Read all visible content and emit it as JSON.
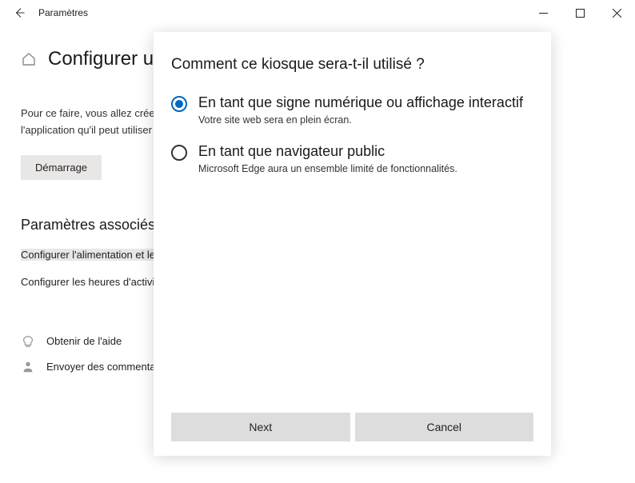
{
  "titlebar": {
    "title": "Paramètres"
  },
  "page": {
    "heading": "Configurer un",
    "intro_line1": "Pour ce faire, vous allez créer uniquement",
    "intro_line2": "l'application qu'il peut utiliser",
    "start_label": "Démarrage"
  },
  "related": {
    "heading": "Paramètres associés",
    "link1": "Configurer l'alimentation et le traîneau",
    "link2": "Configurer les heures d'activité"
  },
  "help": {
    "get_help": "Obtenir de l'aide",
    "feedback": "Envoyer des commentaires"
  },
  "dialog": {
    "title": "Comment ce kiosque sera-t-il utilisé ?",
    "option1": {
      "label": "En tant que signe numérique ou affichage interactif",
      "desc": "Votre site web sera en plein écran.",
      "selected": true
    },
    "option2": {
      "label": "En tant que navigateur public",
      "desc": "Microsoft Edge aura un ensemble limité de fonctionnalités.",
      "selected": false
    },
    "next_label": "Next",
    "cancel_label": "Cancel"
  }
}
